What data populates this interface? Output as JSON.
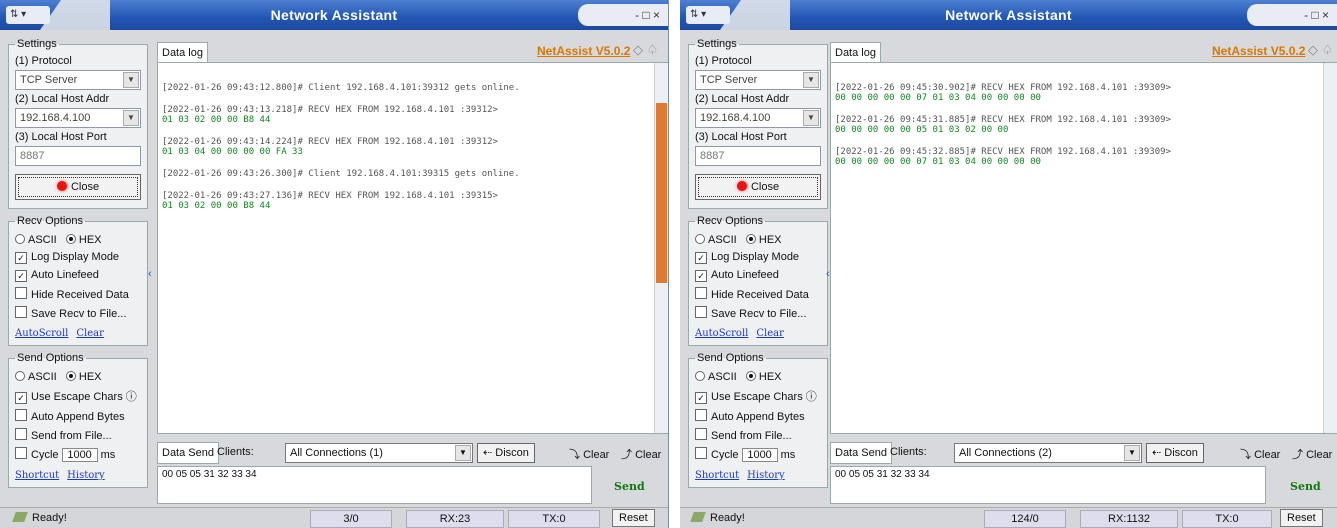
{
  "windows": [
    {
      "title": "Network Assistant",
      "win_controls": "- □ ×",
      "settings": {
        "legend": "Settings",
        "protocol_label": "(1) Protocol",
        "protocol_value": "TCP Server",
        "host_label": "(2) Local Host Addr",
        "host_value": "192.168.4.100",
        "port_label": "(3) Local Host Port",
        "port_value": "8887",
        "close_label": "Close"
      },
      "recv": {
        "legend": "Recv Options",
        "ascii": "ASCII",
        "hex": "HEX",
        "log_display": "Log Display Mode",
        "auto_linefeed": "Auto Linefeed",
        "hide_received": "Hide Received Data",
        "save_recv": "Save Recv to File...",
        "autoscroll": "AutoScroll",
        "clear": "Clear"
      },
      "send_opts": {
        "legend": "Send Options",
        "ascii": "ASCII",
        "hex": "HEX",
        "escape": "Use Escape Chars",
        "append": "Auto Append Bytes",
        "from_file": "Send from File...",
        "cycle": "Cycle",
        "cycle_value": "1000",
        "ms": "ms",
        "shortcut": "Shortcut",
        "history": "History"
      },
      "log_tab": "Data log",
      "brand": "NetAssist V5.0.2",
      "log": [
        {
          "header": "[2022-01-26 09:43:12.800]# Client 192.168.4.101:39312 gets online.",
          "hex": ""
        },
        {
          "header": "[2022-01-26 09:43:13.218]# RECV HEX FROM 192.168.4.101 :39312>",
          "hex": "01 03 02 00 00 B8 44"
        },
        {
          "header": "[2022-01-26 09:43:14.224]# RECV HEX FROM 192.168.4.101 :39312>",
          "hex": "01 03 04 00 00 00 00 FA 33"
        },
        {
          "header": "[2022-01-26 09:43:26.300]# Client 192.168.4.101:39315 gets online.",
          "hex": ""
        },
        {
          "header": "[2022-01-26 09:43:27.136]# RECV HEX FROM 192.168.4.101 :39315>",
          "hex": "01 03 02 00 00 B8 44"
        }
      ],
      "send": {
        "tab": "Data Send",
        "clients_label": "Clients:",
        "connections": "All Connections (1)",
        "disconnect": "Discon",
        "clear1": "Clear",
        "clear2": "Clear",
        "text": "00 05 05 31 32 33 34",
        "send_btn": "Send"
      },
      "status": {
        "ready": "Ready!",
        "count": "3/0",
        "rx": "RX:23",
        "tx": "TX:0",
        "reset": "Reset"
      }
    },
    {
      "title": "Network Assistant",
      "win_controls": "- □ ×",
      "settings": {
        "legend": "Settings",
        "protocol_label": "(1) Protocol",
        "protocol_value": "TCP Server",
        "host_label": "(2) Local Host Addr",
        "host_value": "192.168.4.100",
        "port_label": "(3) Local Host Port",
        "port_value": "8887",
        "close_label": "Close"
      },
      "recv": {
        "legend": "Recv Options",
        "ascii": "ASCII",
        "hex": "HEX",
        "log_display": "Log Display Mode",
        "auto_linefeed": "Auto Linefeed",
        "hide_received": "Hide Received Data",
        "save_recv": "Save Recv to File...",
        "autoscroll": "AutoScroll",
        "clear": "Clear"
      },
      "send_opts": {
        "legend": "Send Options",
        "ascii": "ASCII",
        "hex": "HEX",
        "escape": "Use Escape Chars",
        "append": "Auto Append Bytes",
        "from_file": "Send from File...",
        "cycle": "Cycle",
        "cycle_value": "1000",
        "ms": "ms",
        "shortcut": "Shortcut",
        "history": "History"
      },
      "log_tab": "Data log",
      "brand": "NetAssist V5.0.2",
      "log": [
        {
          "header": "[2022-01-26 09:45:30.902]# RECV HEX FROM 192.168.4.101 :39309>",
          "hex": "00 00 00 00 00 07 01 03 04 00 00 00 00"
        },
        {
          "header": "[2022-01-26 09:45:31.885]# RECV HEX FROM 192.168.4.101 :39309>",
          "hex": "00 00 00 00 00 05 01 03 02 00 00"
        },
        {
          "header": "[2022-01-26 09:45:32.885]# RECV HEX FROM 192.168.4.101 :39309>",
          "hex": "00 00 00 00 00 07 01 03 04 00 00 00 00"
        }
      ],
      "send": {
        "tab": "Data Send",
        "clients_label": "Clients:",
        "connections": "All Connections (2)",
        "disconnect": "Discon",
        "clear1": "Clear",
        "clear2": "Clear",
        "text": "00 05 05 31 32 33 34",
        "send_btn": "Send"
      },
      "status": {
        "ready": "Ready!",
        "count": "124/0",
        "rx": "RX:1132",
        "tx": "TX:0",
        "reset": "Reset"
      }
    }
  ]
}
